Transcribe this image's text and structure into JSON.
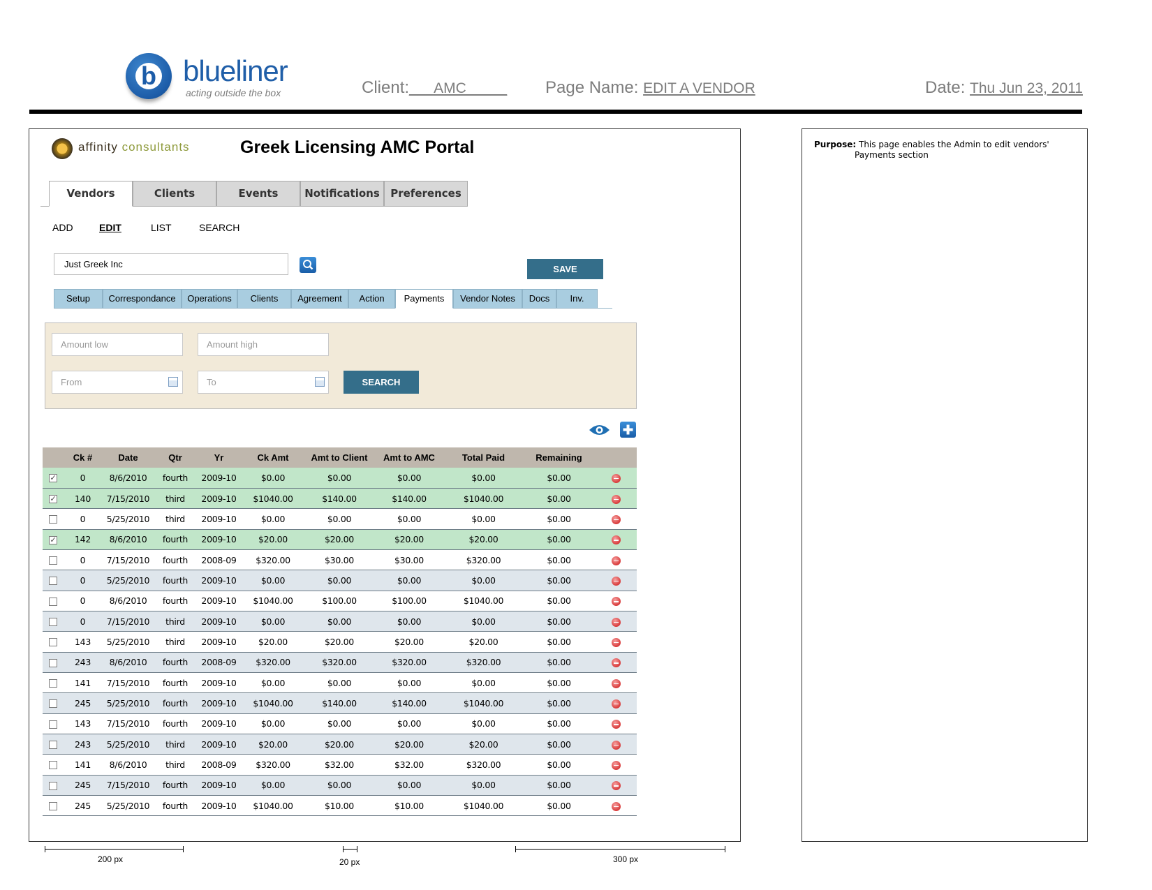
{
  "header": {
    "brand": "blueliner",
    "tagline": "acting outside the box",
    "client_label": "Client:",
    "client_value": "___AMC_____",
    "page_name_label": "Page Name:",
    "page_name_value": "EDIT A VENDOR",
    "date_label": "Date:",
    "date_value": "Thu Jun 23, 2011"
  },
  "purpose": {
    "label": "Purpose:",
    "text_line1": "This page enables the Admin to edit vendors'",
    "text_line2": "Payments section"
  },
  "app": {
    "logo_word1": "affinity",
    "logo_word2": "consultants",
    "title": "Greek Licensing AMC Portal"
  },
  "main_tabs": [
    "Vendors",
    "Clients",
    "Events",
    "Notifications",
    "Preferences"
  ],
  "sub_nav": {
    "add": "ADD",
    "edit": "EDIT",
    "list": "LIST",
    "search": "SEARCH"
  },
  "vendor_search": {
    "value": "Just Greek Inc"
  },
  "save_label": "SAVE",
  "vendor_tabs": [
    "Setup",
    "Correspondance",
    "Operations",
    "Clients",
    "Agreement",
    "Action",
    "Payments",
    "Vendor Notes",
    "Docs",
    "Inv."
  ],
  "filters": {
    "amount_low": "Amount low",
    "amount_high": "Amount high",
    "from": "From",
    "to": "To",
    "search_label": "SEARCH"
  },
  "table": {
    "columns": [
      "",
      "Ck #",
      "Date",
      "Qtr",
      "Yr",
      "Ck Amt",
      "Amt to Client",
      "Amt to AMC",
      "Total Paid",
      "Remaining",
      ""
    ],
    "rows": [
      {
        "checked": true,
        "ck": "0",
        "date": "8/6/2010",
        "qtr": "fourth",
        "yr": "2009-10",
        "ck_amt": "$0.00",
        "client": "$0.00",
        "amc": "$0.00",
        "total": "$0.00",
        "remaining": "$0.00"
      },
      {
        "checked": true,
        "ck": "140",
        "date": "7/15/2010",
        "qtr": "third",
        "yr": "2009-10",
        "ck_amt": "$1040.00",
        "client": "$140.00",
        "amc": "$140.00",
        "total": "$1040.00",
        "remaining": "$0.00"
      },
      {
        "checked": false,
        "ck": "0",
        "date": "5/25/2010",
        "qtr": "third",
        "yr": "2009-10",
        "ck_amt": "$0.00",
        "client": "$0.00",
        "amc": "$0.00",
        "total": "$0.00",
        "remaining": "$0.00"
      },
      {
        "checked": true,
        "ck": "142",
        "date": "8/6/2010",
        "qtr": "fourth",
        "yr": "2009-10",
        "ck_amt": "$20.00",
        "client": "$20.00",
        "amc": "$20.00",
        "total": "$20.00",
        "remaining": "$0.00"
      },
      {
        "checked": false,
        "ck": "0",
        "date": "7/15/2010",
        "qtr": "fourth",
        "yr": "2008-09",
        "ck_amt": "$320.00",
        "client": "$30.00",
        "amc": "$30.00",
        "total": "$320.00",
        "remaining": "$0.00"
      },
      {
        "checked": false,
        "ck": "0",
        "date": "5/25/2010",
        "qtr": "fourth",
        "yr": "2009-10",
        "ck_amt": "$0.00",
        "client": "$0.00",
        "amc": "$0.00",
        "total": "$0.00",
        "remaining": "$0.00"
      },
      {
        "checked": false,
        "ck": "0",
        "date": "8/6/2010",
        "qtr": "fourth",
        "yr": "2009-10",
        "ck_amt": "$1040.00",
        "client": "$100.00",
        "amc": "$100.00",
        "total": "$1040.00",
        "remaining": "$0.00"
      },
      {
        "checked": false,
        "ck": "0",
        "date": "7/15/2010",
        "qtr": "third",
        "yr": "2009-10",
        "ck_amt": "$0.00",
        "client": "$0.00",
        "amc": "$0.00",
        "total": "$0.00",
        "remaining": "$0.00"
      },
      {
        "checked": false,
        "ck": "143",
        "date": "5/25/2010",
        "qtr": "third",
        "yr": "2009-10",
        "ck_amt": "$20.00",
        "client": "$20.00",
        "amc": "$20.00",
        "total": "$20.00",
        "remaining": "$0.00"
      },
      {
        "checked": false,
        "ck": "243",
        "date": "8/6/2010",
        "qtr": "fourth",
        "yr": "2008-09",
        "ck_amt": "$320.00",
        "client": "$320.00",
        "amc": "$320.00",
        "total": "$320.00",
        "remaining": "$0.00"
      },
      {
        "checked": false,
        "ck": "141",
        "date": "7/15/2010",
        "qtr": "fourth",
        "yr": "2009-10",
        "ck_amt": "$0.00",
        "client": "$0.00",
        "amc": "$0.00",
        "total": "$0.00",
        "remaining": "$0.00"
      },
      {
        "checked": false,
        "ck": "245",
        "date": "5/25/2010",
        "qtr": "fourth",
        "yr": "2009-10",
        "ck_amt": "$1040.00",
        "client": "$140.00",
        "amc": "$140.00",
        "total": "$1040.00",
        "remaining": "$0.00"
      },
      {
        "checked": false,
        "ck": "143",
        "date": "7/15/2010",
        "qtr": "fourth",
        "yr": "2009-10",
        "ck_amt": "$0.00",
        "client": "$0.00",
        "amc": "$0.00",
        "total": "$0.00",
        "remaining": "$0.00"
      },
      {
        "checked": false,
        "ck": "243",
        "date": "5/25/2010",
        "qtr": "third",
        "yr": "2009-10",
        "ck_amt": "$20.00",
        "client": "$20.00",
        "amc": "$20.00",
        "total": "$20.00",
        "remaining": "$0.00"
      },
      {
        "checked": false,
        "ck": "141",
        "date": "8/6/2010",
        "qtr": "third",
        "yr": "2008-09",
        "ck_amt": "$320.00",
        "client": "$32.00",
        "amc": "$32.00",
        "total": "$320.00",
        "remaining": "$0.00"
      },
      {
        "checked": false,
        "ck": "245",
        "date": "7/15/2010",
        "qtr": "fourth",
        "yr": "2009-10",
        "ck_amt": "$0.00",
        "client": "$0.00",
        "amc": "$0.00",
        "total": "$0.00",
        "remaining": "$0.00"
      },
      {
        "checked": false,
        "ck": "245",
        "date": "5/25/2010",
        "qtr": "fourth",
        "yr": "2009-10",
        "ck_amt": "$1040.00",
        "client": "$10.00",
        "amc": "$10.00",
        "total": "$1040.00",
        "remaining": "$0.00"
      }
    ]
  },
  "dimensions": {
    "left": "200 px",
    "middle": "20 px",
    "right": "300 px"
  },
  "colors": {
    "brand_blue": "#1f5ea8",
    "button_teal": "#346e8a",
    "tab_blue": "#a9cde0",
    "selected_row": "#c1e6c9",
    "filter_bg": "#f2ead9"
  }
}
